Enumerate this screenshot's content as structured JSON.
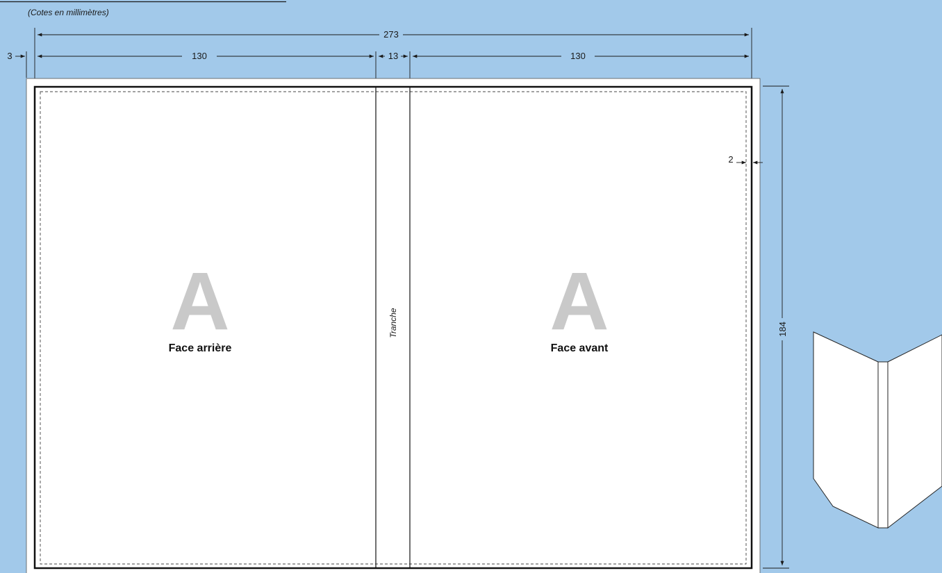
{
  "note": "(Cotes en millimètres)",
  "dimensions": {
    "total_width": "273",
    "bleed": "3",
    "back_width": "130",
    "spine_width": "13",
    "front_width": "130",
    "height": "184",
    "margin": "2"
  },
  "panels": {
    "back": {
      "letter": "A",
      "label": "Face arrière"
    },
    "spine": {
      "label": "Tranche"
    },
    "front": {
      "letter": "A",
      "label": "Face avant"
    }
  },
  "colors": {
    "background": "#a2c9ea",
    "paper": "#ffffff",
    "letter": "#c9c9c9",
    "line": "#1a1a1a"
  }
}
